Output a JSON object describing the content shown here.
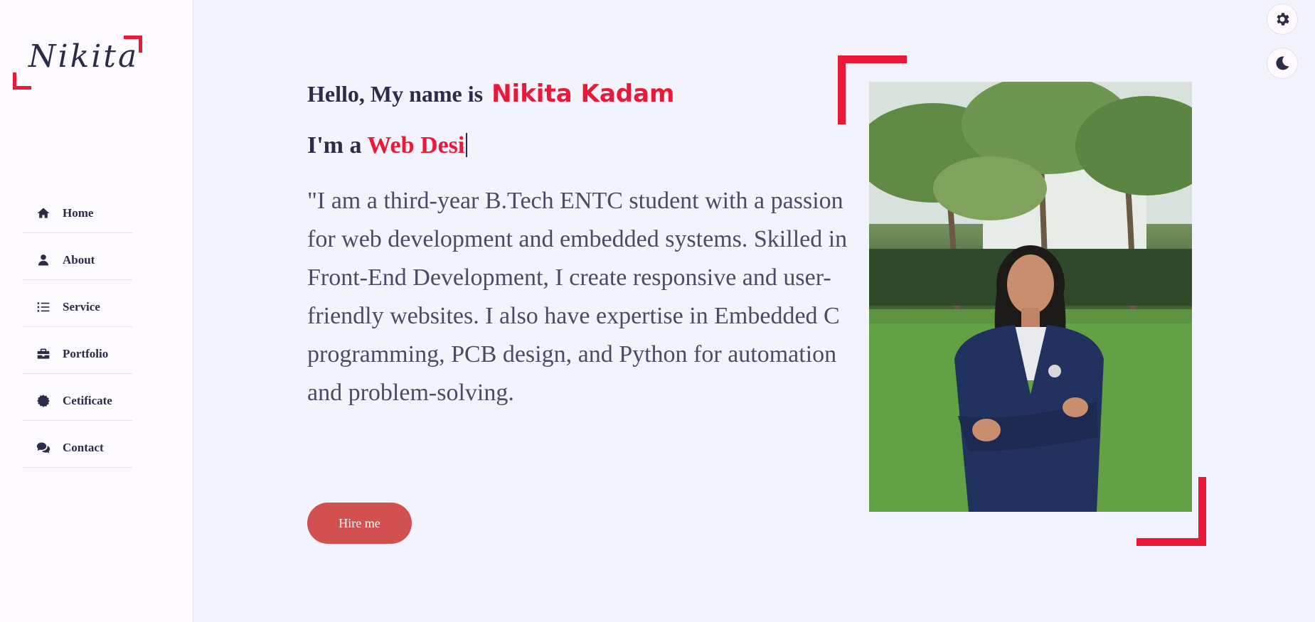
{
  "logo": {
    "text": "Nikita"
  },
  "nav": {
    "items": [
      {
        "label": "Home",
        "icon": "home-icon"
      },
      {
        "label": "About",
        "icon": "user-icon"
      },
      {
        "label": "Service",
        "icon": "list-icon"
      },
      {
        "label": "Portfolio",
        "icon": "briefcase-icon"
      },
      {
        "label": "Cetificate",
        "icon": "certificate-icon"
      },
      {
        "label": "Contact",
        "icon": "comments-icon"
      }
    ]
  },
  "hero": {
    "greeting_prefix": "Hello, My name is",
    "name": "Nikita Kadam",
    "role_prefix": "I'm a",
    "role_typed": "Web Desi",
    "bio": "\"I am a third-year B.Tech ENTC student with a passion for web development and embedded systems. Skilled in Front-End Development, I create responsive and user-friendly websites. I also have expertise in Embedded C programming, PCB design, and Python for automation and problem-solving.",
    "hire_label": "Hire me"
  },
  "controls": {
    "settings_icon": "gear-icon",
    "theme_icon": "moon-icon"
  },
  "colors": {
    "accent": "#ec1839",
    "text_dark": "#2b2c48",
    "button": "#d25050",
    "background": "#f2f3fc",
    "sidebar": "#fcf9ff"
  }
}
